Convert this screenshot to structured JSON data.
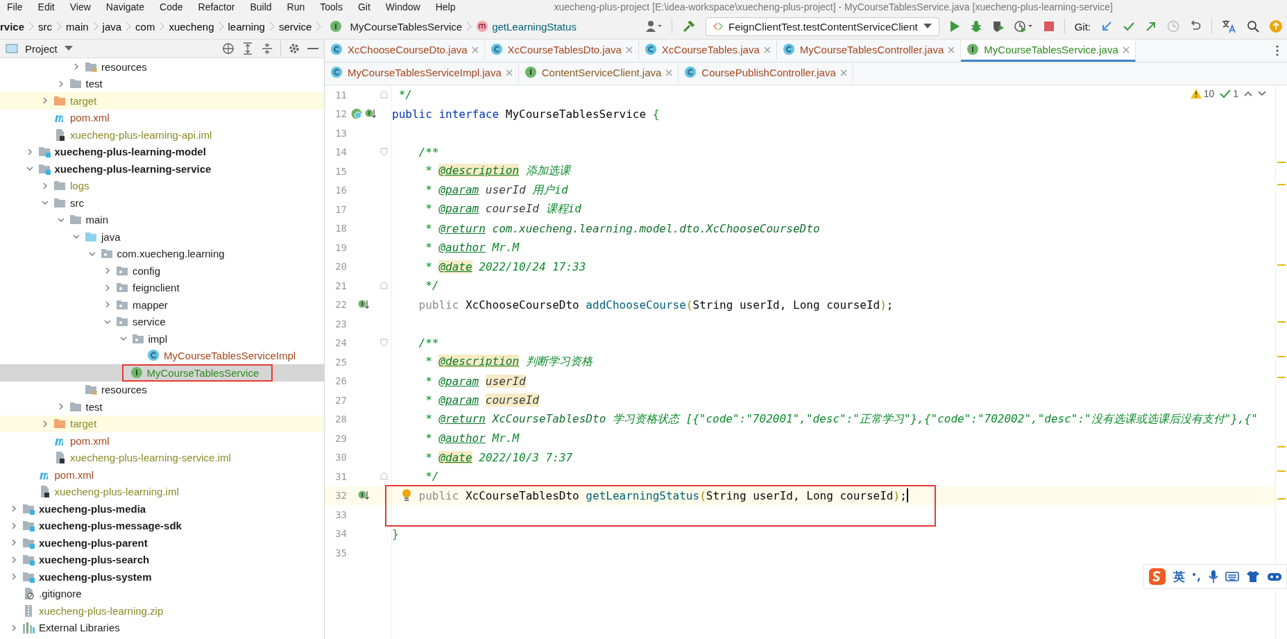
{
  "menu": [
    "File",
    "Edit",
    "View",
    "Navigate",
    "Code",
    "Refactor",
    "Build",
    "Run",
    "Tools",
    "Git",
    "Window",
    "Help"
  ],
  "window_title": "xuecheng-plus-project [E:\\idea-workspace\\xuecheng-plus-project] - MyCourseTablesService.java [xuecheng-plus-learning-service]",
  "breadcrumbs": [
    {
      "label": "rvice",
      "kind": "module"
    },
    {
      "label": "src",
      "kind": "plain"
    },
    {
      "label": "main",
      "kind": "plain"
    },
    {
      "label": "java",
      "kind": "plain"
    },
    {
      "label": "com",
      "kind": "plain"
    },
    {
      "label": "xuecheng",
      "kind": "plain"
    },
    {
      "label": "learning",
      "kind": "plain"
    },
    {
      "label": "service",
      "kind": "plain"
    },
    {
      "label": "MyCourseTablesService",
      "kind": "interface"
    },
    {
      "label": "getLearningStatus",
      "kind": "method"
    }
  ],
  "run_config": {
    "label": "FeignClientTest.testContentServiceClient"
  },
  "git_label": "Git:",
  "project_panel": {
    "title": "Project",
    "tree": [
      {
        "children": [
          {
            "children": [
              {
                "children": [
                  {
                    "children": [
                      {
                        "label": "resources",
                        "kind": "resources",
                        "expanded": false
                      }
                    ]
                  },
                  {
                    "label": "test",
                    "kind": "folder",
                    "expanded": false
                  }
                ]
              },
              {
                "label": "target",
                "kind": "excluded",
                "expanded": false,
                "color": "#8a8a2a"
              },
              {
                "label": "pom.xml",
                "kind": "maven",
                "color": "#a5461d"
              },
              {
                "label": "xuecheng-plus-learning-api.iml",
                "kind": "iml",
                "color": "#8a8a2a"
              }
            ]
          },
          {
            "label": "xuecheng-plus-learning-model",
            "kind": "module",
            "expanded": false
          },
          {
            "label": "xuecheng-plus-learning-service",
            "kind": "module",
            "expanded": true,
            "children": [
              {
                "label": "logs",
                "kind": "folder",
                "expanded": false,
                "color": "#8a8a2a"
              },
              {
                "label": "src",
                "kind": "folder",
                "expanded": true,
                "children": [
                  {
                    "label": "main",
                    "kind": "folder",
                    "expanded": true,
                    "children": [
                      {
                        "label": "java",
                        "kind": "source",
                        "expanded": true,
                        "children": [
                          {
                            "label": "com.xuecheng.learning",
                            "kind": "package",
                            "expanded": true,
                            "children": [
                              {
                                "label": "config",
                                "kind": "package",
                                "expanded": false
                              },
                              {
                                "label": "feignclient",
                                "kind": "package",
                                "expanded": false
                              },
                              {
                                "label": "mapper",
                                "kind": "package",
                                "expanded": false
                              },
                              {
                                "label": "service",
                                "kind": "package",
                                "expanded": true,
                                "children": [
                                  {
                                    "label": "impl",
                                    "kind": "package",
                                    "expanded": true,
                                    "children": [
                                      {
                                        "label": "MyCourseTablesServiceImpl",
                                        "kind": "class",
                                        "color": "#a5461d",
                                        "selected": false
                                      }
                                    ]
                                  },
                                  {
                                    "label": "MyCourseTablesService",
                                    "kind": "interface",
                                    "color": "#2f8a1f",
                                    "selected": true,
                                    "boxed": true
                                  }
                                ]
                              }
                            ]
                          }
                        ]
                      },
                      {
                        "label": "resources",
                        "kind": "resources"
                      }
                    ]
                  },
                  {
                    "label": "test",
                    "kind": "folder",
                    "expanded": false
                  }
                ]
              },
              {
                "label": "target",
                "kind": "excluded",
                "expanded": false,
                "color": "#8a8a2a"
              },
              {
                "label": "pom.xml",
                "kind": "maven",
                "color": "#a5461d"
              },
              {
                "label": "xuecheng-plus-learning-service.iml",
                "kind": "iml",
                "color": "#8a8a2a"
              }
            ]
          },
          {
            "label": "pom.xml",
            "kind": "maven",
            "color": "#a5461d"
          },
          {
            "label": "xuecheng-plus-learning.iml",
            "kind": "iml",
            "color": "#8a8a2a"
          }
        ]
      },
      {
        "label": "xuecheng-plus-media",
        "kind": "module",
        "expanded": false
      },
      {
        "label": "xuecheng-plus-message-sdk",
        "kind": "module",
        "expanded": false
      },
      {
        "label": "xuecheng-plus-parent",
        "kind": "module",
        "expanded": false
      },
      {
        "label": "xuecheng-plus-search",
        "kind": "module",
        "expanded": false
      },
      {
        "label": "xuecheng-plus-system",
        "kind": "module",
        "expanded": false
      },
      {
        "label": ".gitignore",
        "kind": "gitignore"
      },
      {
        "label": "xuecheng-plus-learning.zip",
        "kind": "zip",
        "color": "#8a8a2a"
      },
      {
        "label": "External Libraries",
        "kind": "libraries",
        "expanded": false
      }
    ]
  },
  "tab_rows": [
    {
      "tabs": [
        {
          "label": "XcChooseCourseDto.java",
          "kind": "class",
          "selected": false
        },
        {
          "label": "XcCourseTablesDto.java",
          "kind": "class",
          "selected": false
        },
        {
          "label": "XcCourseTables.java",
          "kind": "class",
          "selected": false
        },
        {
          "label": "MyCourseTablesController.java",
          "kind": "class",
          "selected": false
        },
        {
          "label": "MyCourseTablesService.java",
          "kind": "interface",
          "selected": true
        }
      ]
    },
    {
      "tabs": [
        {
          "label": "MyCourseTablesServiceImpl.java",
          "kind": "class",
          "selected": false
        },
        {
          "label": "ContentServiceClient.java",
          "kind": "interface",
          "selected": false
        },
        {
          "label": "CoursePublishController.java",
          "kind": "class",
          "selected": false
        }
      ]
    }
  ],
  "editor": {
    "inspections": {
      "warnings": "10",
      "passed": "1"
    },
    "lines": [
      {
        "number": "11",
        "fold_marker": {
          "kind": "end"
        },
        "segments": [
          {
            "text": " */",
            "kind": "doc"
          }
        ]
      },
      {
        "number": "12",
        "gutter_marker": {
          "kind": "implemented-both"
        },
        "segments": [
          {
            "text": "public",
            "kind": "kw"
          },
          {
            "text": " interface",
            "kind": "kw"
          },
          {
            "text": " MyCourseTablesService ",
            "kind": "plain"
          },
          {
            "text": "{",
            "kind": "brace"
          }
        ]
      },
      {
        "number": "13"
      },
      {
        "number": "14",
        "fold_marker": {
          "kind": "start"
        },
        "segments": [
          {
            "text": "    /**",
            "kind": "doc"
          }
        ]
      },
      {
        "number": "15",
        "segments": [
          {
            "text": "     * ",
            "kind": "doc"
          },
          {
            "text": "@description",
            "kind": "tag_hl"
          },
          {
            "text": " 添加选课",
            "kind": "doc"
          }
        ]
      },
      {
        "number": "16",
        "segments": [
          {
            "text": "     * ",
            "kind": "doc"
          },
          {
            "text": "@param",
            "kind": "tag"
          },
          {
            "text": " userId",
            "kind": "param"
          },
          {
            "text": " 用户id",
            "kind": "doc"
          }
        ]
      },
      {
        "number": "17",
        "segments": [
          {
            "text": "     * ",
            "kind": "doc"
          },
          {
            "text": "@param",
            "kind": "tag"
          },
          {
            "text": " courseId",
            "kind": "param"
          },
          {
            "text": " 课程id",
            "kind": "doc"
          }
        ]
      },
      {
        "number": "18",
        "segments": [
          {
            "text": "     * ",
            "kind": "doc"
          },
          {
            "text": "@return",
            "kind": "tag"
          },
          {
            "text": " com.xuecheng.learning.model.dto.XcChooseCourseDto",
            "kind": "ref"
          }
        ]
      },
      {
        "number": "19",
        "segments": [
          {
            "text": "     * ",
            "kind": "doc"
          },
          {
            "text": "@author",
            "kind": "tag"
          },
          {
            "text": " Mr.M",
            "kind": "doc"
          }
        ]
      },
      {
        "number": "20",
        "segments": [
          {
            "text": "     * ",
            "kind": "doc"
          },
          {
            "text": "@date",
            "kind": "tag_hl"
          },
          {
            "text": " 2022/10/24 17:33",
            "kind": "doc"
          }
        ]
      },
      {
        "number": "21",
        "fold_marker": {
          "kind": "end"
        },
        "segments": [
          {
            "text": "     */",
            "kind": "doc"
          }
        ]
      },
      {
        "number": "22",
        "gutter_marker": {
          "kind": "implemented"
        },
        "segments": [
          {
            "text": "    public",
            "kind": "kw_gray"
          },
          {
            "text": " XcChooseCourseDto ",
            "kind": "plain"
          },
          {
            "text": "addChooseCourse",
            "kind": "method"
          },
          {
            "text": "(",
            "kind": "paren"
          },
          {
            "text": "String userId, Long courseId",
            "kind": "plain"
          },
          {
            "text": ")",
            "kind": "paren"
          },
          {
            "text": ";",
            "kind": "plain"
          }
        ]
      },
      {
        "number": "23"
      },
      {
        "number": "24",
        "fold_marker": {
          "kind": "start"
        },
        "segments": [
          {
            "text": "    /**",
            "kind": "doc"
          }
        ]
      },
      {
        "number": "25",
        "segments": [
          {
            "text": "     * ",
            "kind": "doc"
          },
          {
            "text": "@description",
            "kind": "tag_hl"
          },
          {
            "text": " 判断学习资格",
            "kind": "doc"
          }
        ]
      },
      {
        "number": "26",
        "segments": [
          {
            "text": "     * ",
            "kind": "doc"
          },
          {
            "text": "@param",
            "kind": "tag"
          },
          {
            "text": "userId",
            "kind": "param_hl"
          }
        ]
      },
      {
        "number": "27",
        "segments": [
          {
            "text": "     * ",
            "kind": "doc"
          },
          {
            "text": "@param",
            "kind": "tag"
          },
          {
            "text": "courseId",
            "kind": "param_hl"
          }
        ]
      },
      {
        "number": "28",
        "segments": [
          {
            "text": "     * ",
            "kind": "doc"
          },
          {
            "text": "@return",
            "kind": "tag"
          },
          {
            "text": " XcCourseTablesDto",
            "kind": "ref"
          },
          {
            "text": " 学习资格状态 [{\"code\":\"702001\",\"desc\":\"正常学习\"},{\"code\":\"702002\",\"desc\":\"没有选课或选课后没有支付\"},{\"",
            "kind": "doc"
          }
        ]
      },
      {
        "number": "29",
        "segments": [
          {
            "text": "     * ",
            "kind": "doc"
          },
          {
            "text": "@author",
            "kind": "tag"
          },
          {
            "text": " Mr.M",
            "kind": "doc"
          }
        ]
      },
      {
        "number": "30",
        "segments": [
          {
            "text": "     * ",
            "kind": "doc"
          },
          {
            "text": "@date",
            "kind": "tag_hl"
          },
          {
            "text": " 2022/10/3 7:37",
            "kind": "doc"
          }
        ]
      },
      {
        "number": "31",
        "fold_marker": {
          "kind": "end"
        },
        "segments": [
          {
            "text": "     */",
            "kind": "doc"
          }
        ]
      },
      {
        "number": "32",
        "gutter_marker": {
          "kind": "implemented"
        },
        "current": true,
        "bulb": true,
        "caret": true,
        "boxed": true,
        "segments": [
          {
            "text": "    public",
            "kind": "kw_gray"
          },
          {
            "text": " XcCourseTablesDto ",
            "kind": "plain"
          },
          {
            "text": "getLearningStatus",
            "kind": "method"
          },
          {
            "text": "(",
            "kind": "paren"
          },
          {
            "text": "String userId, Long courseId",
            "kind": "plain"
          },
          {
            "text": ")",
            "kind": "paren"
          },
          {
            "text": ";",
            "kind": "plain"
          }
        ]
      },
      {
        "number": "33"
      },
      {
        "number": "34",
        "segments": [
          {
            "text": "}",
            "kind": "brace"
          }
        ]
      },
      {
        "number": "35"
      }
    ]
  },
  "ime": {
    "mode": "英"
  }
}
